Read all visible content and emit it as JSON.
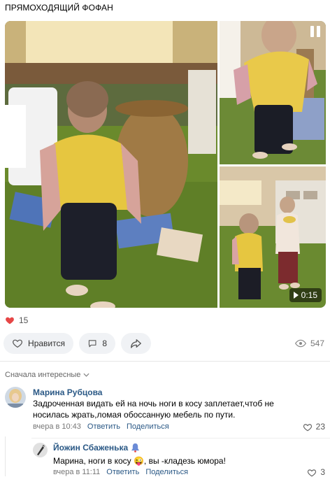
{
  "post": {
    "title": "ПРЯМОХОДЯЩИЙ ФОФАН",
    "video_duration": "0:15",
    "likes_count": "15",
    "like_label": "Нравится",
    "comments_count": "8",
    "views_count": "547"
  },
  "comments_section": {
    "sort_label": "Сначала интересные"
  },
  "comments": [
    {
      "author": "Марина Рубцова",
      "text": "Задроченная видать ей на ночь ноги в косу заплетает,чтоб не носилась жрать,ломая обоссанную мебель по пути.",
      "time": "вчера в 10:43",
      "reply_label": "Ответить",
      "share_label": "Поделиться",
      "likes": "23"
    },
    {
      "author": "Йожин Сбаженька",
      "text": "Марина, ноги в косу 😜, вы -кладезь юмора!",
      "time": "вчера в 11:11",
      "reply_label": "Ответить",
      "share_label": "Поделиться",
      "likes": "3"
    }
  ],
  "colors": {
    "accent": "#2a5885",
    "like_red": "#e64646",
    "button_bg": "#f0f2f5"
  }
}
